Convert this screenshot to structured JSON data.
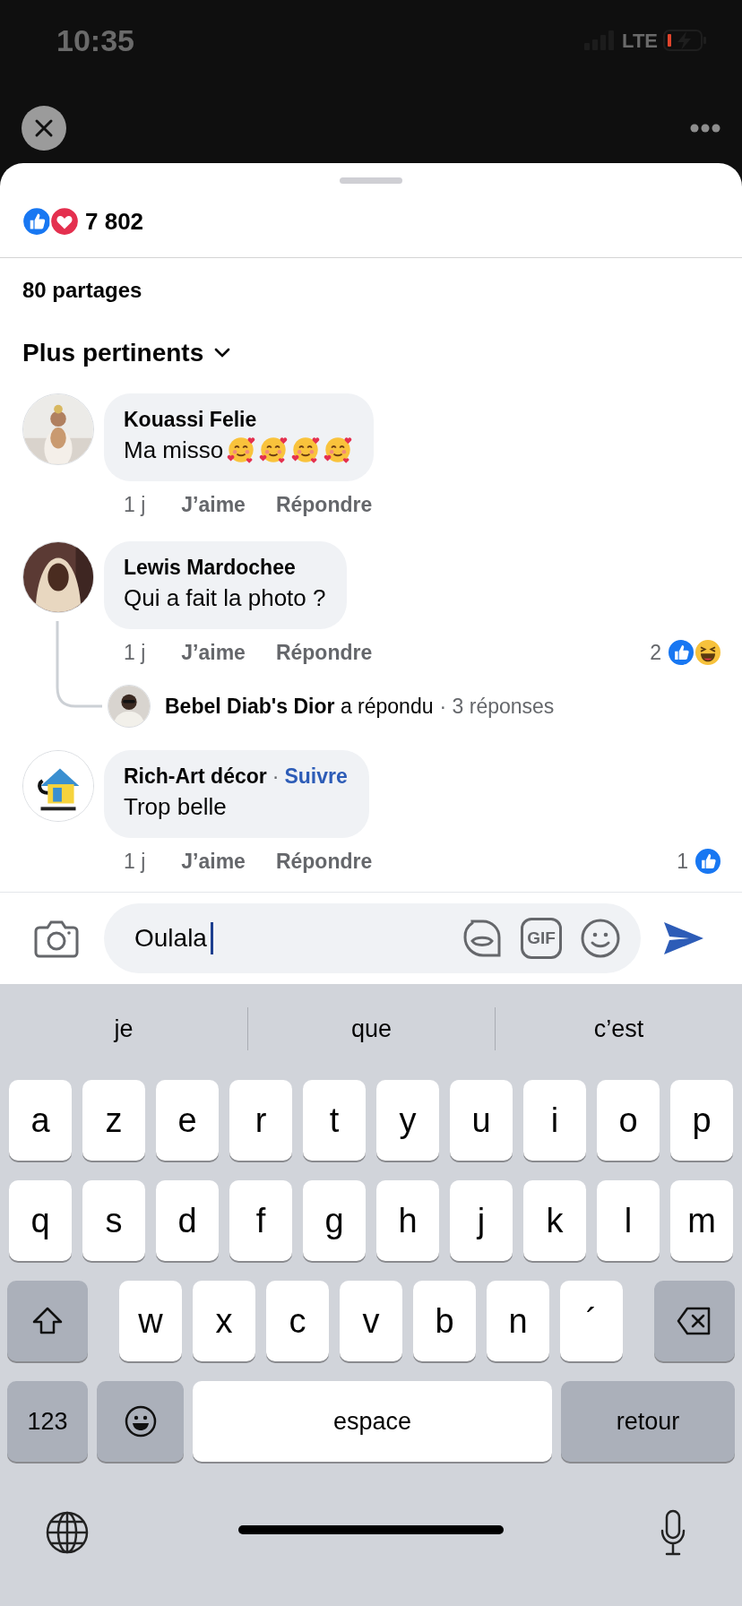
{
  "status_bar": {
    "time": "10:35",
    "network": "LTE"
  },
  "reactions_summary": {
    "icons": [
      {
        "kind": "like"
      },
      {
        "kind": "love"
      }
    ],
    "count": "7 802"
  },
  "shares": "80 partages",
  "sort": {
    "label": "Plus pertinents"
  },
  "comments": [
    {
      "author": "Kouassi Felie",
      "text": "Ma misso",
      "emojis": [
        {
          "kind": "smiling_hearts"
        },
        {
          "kind": "smiling_hearts"
        },
        {
          "kind": "smiling_hearts"
        },
        {
          "kind": "smiling_hearts"
        }
      ],
      "time": "1 j",
      "like": "J’aime",
      "reply": "Répondre"
    },
    {
      "author": "Lewis Mardochee",
      "text": "Qui a fait la photo ?",
      "time": "1 j",
      "like": "J’aime",
      "reply": "Répondre",
      "reactions": {
        "count": "2",
        "icons": [
          {
            "kind": "like"
          },
          {
            "kind": "haha"
          }
        ]
      },
      "replies": {
        "summary": "**Bebel Diab's Dior** a répondu",
        "count": "· 3 réponses"
      }
    },
    {
      "author": "Rich-Art décor",
      "separator": "·",
      "follow": "Suivre",
      "text": "Trop belle",
      "time": "1 j",
      "like": "J’aime",
      "reply": "Répondre",
      "reactions": {
        "count": "1",
        "icons": [
          {
            "kind": "like"
          }
        ]
      }
    }
  ],
  "composer": {
    "value": "Oulala",
    "gif": "GIF"
  },
  "keyboard": {
    "suggestions": [
      "je",
      "que",
      "c’est"
    ],
    "rows": [
      {
        "keys": [
          {
            "kind": "letter",
            "label": "a"
          },
          {
            "kind": "letter",
            "label": "z"
          },
          {
            "kind": "letter",
            "label": "e"
          },
          {
            "kind": "letter",
            "label": "r"
          },
          {
            "kind": "letter",
            "label": "t"
          },
          {
            "kind": "letter",
            "label": "y"
          },
          {
            "kind": "letter",
            "label": "u"
          },
          {
            "kind": "letter",
            "label": "i"
          },
          {
            "kind": "letter",
            "label": "o"
          },
          {
            "kind": "letter",
            "label": "p"
          }
        ]
      },
      {
        "keys": [
          {
            "kind": "letter",
            "label": "q"
          },
          {
            "kind": "letter",
            "label": "s"
          },
          {
            "kind": "letter",
            "label": "d"
          },
          {
            "kind": "letter",
            "label": "f"
          },
          {
            "kind": "letter",
            "label": "g"
          },
          {
            "kind": "letter",
            "label": "h"
          },
          {
            "kind": "letter",
            "label": "j"
          },
          {
            "kind": "letter",
            "label": "k"
          },
          {
            "kind": "letter",
            "label": "l"
          },
          {
            "kind": "letter",
            "label": "m"
          }
        ]
      },
      {
        "keys": [
          {
            "kind": "shift"
          },
          {
            "kind": "letter",
            "label": "w"
          },
          {
            "kind": "letter",
            "label": "x"
          },
          {
            "kind": "letter",
            "label": "c"
          },
          {
            "kind": "letter",
            "label": "v"
          },
          {
            "kind": "letter",
            "label": "b"
          },
          {
            "kind": "letter",
            "label": "n"
          },
          {
            "kind": "letter",
            "label": "´"
          },
          {
            "kind": "delete"
          }
        ]
      }
    ],
    "bottom_row": {
      "keys": [
        {
          "kind": "numbers",
          "label": "123"
        },
        {
          "kind": "emoji"
        },
        {
          "kind": "space",
          "label": "espace"
        },
        {
          "kind": "return",
          "label": "retour"
        }
      ]
    }
  }
}
